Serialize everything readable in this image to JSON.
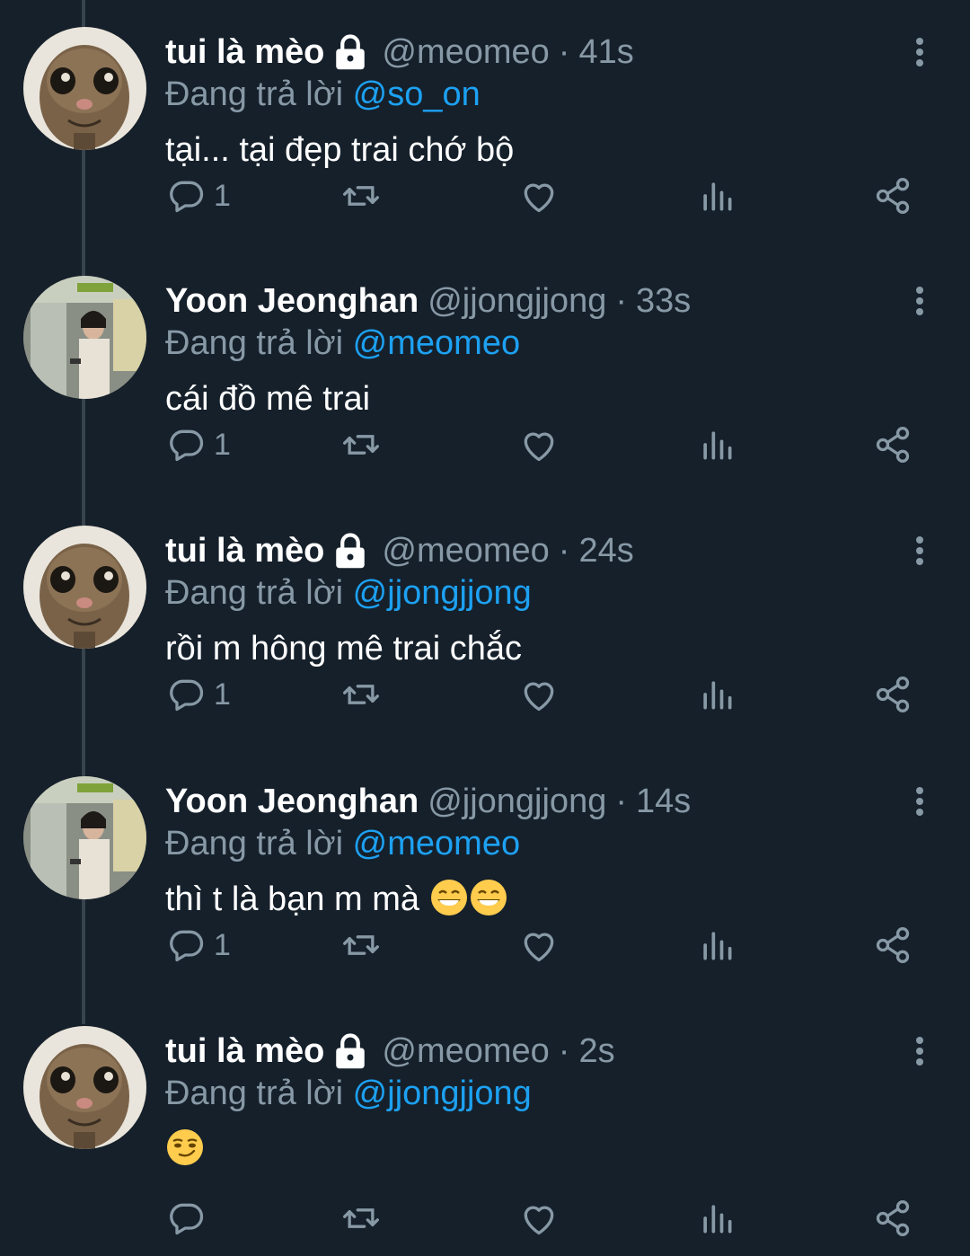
{
  "colors": {
    "background": "#15202b",
    "secondary_text": "#8899a6",
    "mention": "#1da1f2",
    "thread_line": "#38444d"
  },
  "reply_prefix": "Đang trả lời",
  "tweets": [
    {
      "name": "tui là mèo",
      "locked": true,
      "handle": "@meomeo",
      "separator": "·",
      "time": "41s",
      "reply_to": "@so_on",
      "text": "tại... tại đẹp trai chớ bộ",
      "reply_count": "1",
      "avatar_icon": "cat-avatar",
      "emoji": []
    },
    {
      "name": "Yoon Jeonghan",
      "locked": false,
      "handle": "@jjongjjong",
      "separator": "·",
      "time": "33s",
      "reply_to": "@meomeo",
      "text": "cái đồ mê trai",
      "reply_count": "1",
      "avatar_icon": "person-photo-avatar",
      "emoji": []
    },
    {
      "name": "tui là mèo",
      "locked": true,
      "handle": "@meomeo",
      "separator": "·",
      "time": "24s",
      "reply_to": "@jjongjjong",
      "text": "rồi m hông mê trai chắc",
      "reply_count": "1",
      "avatar_icon": "cat-avatar",
      "emoji": []
    },
    {
      "name": "Yoon Jeonghan",
      "locked": false,
      "handle": "@jjongjjong",
      "separator": "·",
      "time": "14s",
      "reply_to": "@meomeo",
      "text": "thì t là bạn m mà",
      "reply_count": "1",
      "avatar_icon": "person-photo-avatar",
      "emoji": [
        "grinning-face",
        "grinning-face"
      ]
    },
    {
      "name": "tui là mèo",
      "locked": true,
      "handle": "@meomeo",
      "separator": "·",
      "time": "2s",
      "reply_to": "@jjongjjong",
      "text": "",
      "reply_count": "",
      "avatar_icon": "cat-avatar",
      "emoji": [
        "smirking-face"
      ]
    }
  ]
}
